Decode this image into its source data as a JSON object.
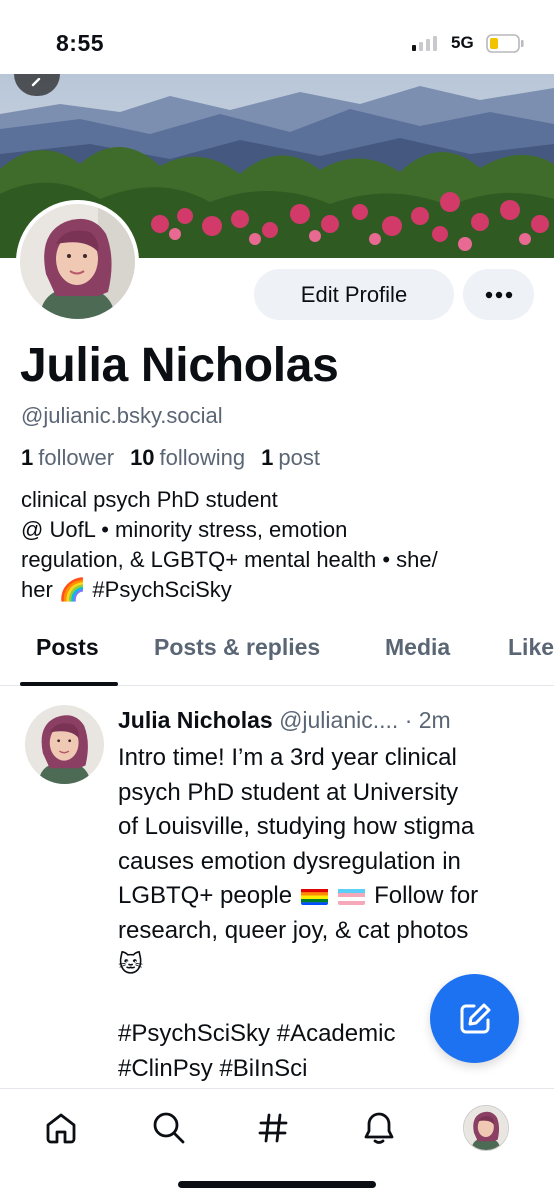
{
  "status_bar": {
    "time": "8:55",
    "network": "5G"
  },
  "profile": {
    "display_name": "Julia Nicholas",
    "handle": "@julianic.bsky.social",
    "followers_count": "1",
    "followers_label": "follower",
    "following_count": "10",
    "following_label": "following",
    "posts_count": "1",
    "posts_label": "post",
    "bio_lines": [
      "clinical psych PhD student",
      "@ UofL • minority stress, emotion",
      "regulation, & LGBTQ+ mental health • she/",
      "her 🌈 #PsychSciSky"
    ]
  },
  "actions": {
    "edit_profile_label": "Edit Profile",
    "more_icon": "ellipsis-icon"
  },
  "tabs": [
    {
      "label": "Posts",
      "active": true
    },
    {
      "label": "Posts & replies",
      "active": false
    },
    {
      "label": "Media",
      "active": false
    },
    {
      "label": "Like",
      "active": false
    }
  ],
  "post": {
    "author": "Julia Nicholas",
    "handle": "@julianic....",
    "separator": "·",
    "time": "2m",
    "lines": [
      "Intro time! I’m a 3rd year clinical",
      "psych PhD student at University",
      "of Louisville, studying how stigma",
      "causes emotion dysregulation in",
      "LGBTQ+ people",
      "research, queer joy, & cat photos",
      "🐱",
      "",
      "#PsychSciSky #Academic",
      "#ClinPsy #BiInSci"
    ],
    "line5_suffix": "Follow for"
  },
  "bottom_nav": [
    "home-icon",
    "search-icon",
    "hashtag-icon",
    "notifications-icon",
    "profile-avatar"
  ],
  "colors": {
    "accent": "#1d72f2",
    "muted": "#5b6675",
    "text": "#0b0f14"
  }
}
